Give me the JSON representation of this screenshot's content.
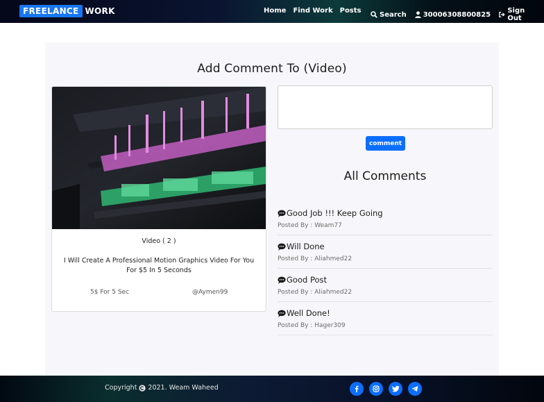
{
  "navbar": {
    "brand_box": "FREELANCE",
    "brand_rest": "WORK",
    "links": [
      "Home",
      "Find Work",
      "Posts"
    ],
    "search_label": "Search",
    "user_label": "30006308800825",
    "signout_label": "Sign Out"
  },
  "page": {
    "title": "Add Comment To (Video)"
  },
  "card": {
    "type_label": "Video ( 2 )",
    "description": "I Will Create A Professional Motion Graphics Video For You For $5 In 5 Seconds",
    "price": "5$ For 5 Sec",
    "user": "@Aymen99"
  },
  "form": {
    "comment_value": "",
    "button_label": "comment"
  },
  "comments_section": {
    "title": "All Comments",
    "items": [
      {
        "text": "Good Job !!! Keep Going",
        "by": "Posted By : Weam77"
      },
      {
        "text": "Will Done",
        "by": "Posted By : Aliahmed22"
      },
      {
        "text": "Good Post",
        "by": "Posted By : Aliahmed22"
      },
      {
        "text": "Well Done!",
        "by": "Posted By : Hager309"
      }
    ]
  },
  "footer": {
    "copyright_prefix": "Copyright",
    "copyright_suffix": "2021. Weam Waheed",
    "socials": [
      "facebook-icon",
      "instagram-icon",
      "twitter-icon",
      "telegram-icon"
    ]
  },
  "colors": {
    "accent": "#0d6efd",
    "brand": "#1877f2"
  }
}
